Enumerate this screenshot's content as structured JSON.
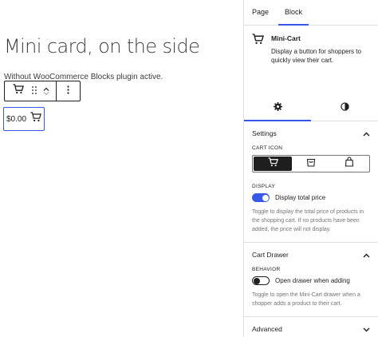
{
  "canvas": {
    "title": "Mini card, on the side",
    "paragraph": "Without WooCommerce Blocks plugin active.",
    "mini_cart_price": "$0.00"
  },
  "sidebar": {
    "tabs": [
      {
        "label": "Page",
        "active": false
      },
      {
        "label": "Block",
        "active": true
      }
    ],
    "block": {
      "name": "Mini-Cart",
      "description": "Display a button for shoppers to quickly view their cart."
    },
    "settings": {
      "title": "Settings",
      "cart_icon_label": "CART ICON",
      "cart_icon_options": [
        "cart-icon",
        "bag-icon",
        "bag-alt-icon"
      ],
      "cart_icon_selected": "cart-icon",
      "display_label": "DISPLAY",
      "display_total_label": "Display total price",
      "display_total_on": true,
      "display_total_help": "Toggle to display the total price of products in the shopping cart. If no products have been added, the price will not display."
    },
    "cart_drawer": {
      "title": "Cart Drawer",
      "behavior_label": "BEHAVIOR",
      "open_drawer_label": "Open drawer when adding",
      "open_drawer_on": false,
      "open_drawer_help": "Toggle to open the Mini-Cart drawer when a shopper adds a product to their cart."
    },
    "advanced": {
      "title": "Advanced"
    }
  },
  "colors": {
    "accent": "#3858e9",
    "text": "#1e1e1e",
    "muted": "#757575",
    "border": "#e0e0e0"
  }
}
